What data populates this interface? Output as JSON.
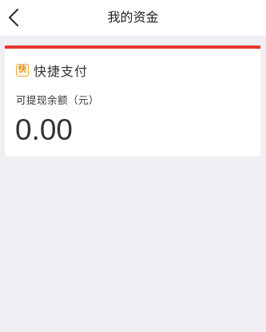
{
  "header": {
    "title": "我的资金",
    "back_icon": "chevron-left-icon"
  },
  "card": {
    "accent_color": "#e8352f",
    "pay_icon_char": "快",
    "pay_title": "快捷支付",
    "balance_label": "可提现余额（元）",
    "balance_value": "0.00"
  }
}
